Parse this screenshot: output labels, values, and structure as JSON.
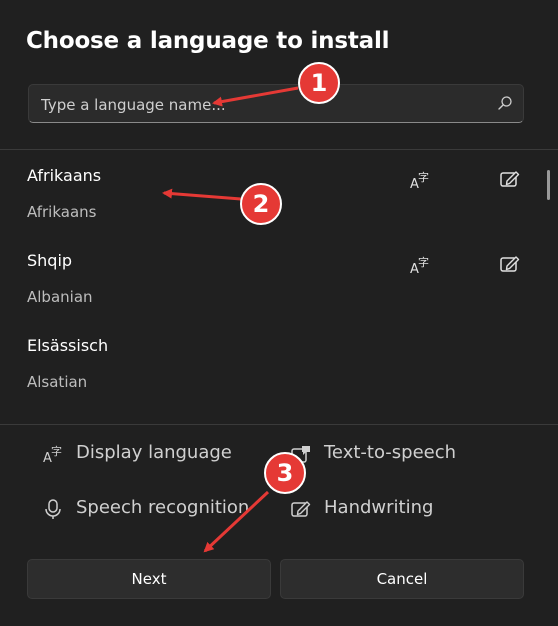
{
  "dialog": {
    "title": "Choose a language to install",
    "search": {
      "placeholder": "Type a language name..."
    },
    "languages": [
      {
        "native": "Afrikaans",
        "english": "Afrikaans",
        "features": [
          "display-language-icon",
          "handwriting-icon"
        ]
      },
      {
        "native": "Shqip",
        "english": "Albanian",
        "features": [
          "display-language-icon",
          "handwriting-icon"
        ]
      },
      {
        "native": "Elsässisch",
        "english": "Alsatian",
        "features": []
      }
    ],
    "legend": {
      "display_language": "Display language",
      "text_to_speech": "Text-to-speech",
      "speech_recognition": "Speech recognition",
      "handwriting": "Handwriting"
    },
    "buttons": {
      "next": "Next",
      "cancel": "Cancel"
    }
  },
  "annotations": {
    "badge_1": "1",
    "badge_2": "2",
    "badge_3": "3"
  },
  "colors": {
    "background": "#202020",
    "annotation": "#e53935",
    "button": "#2d2d2d"
  }
}
